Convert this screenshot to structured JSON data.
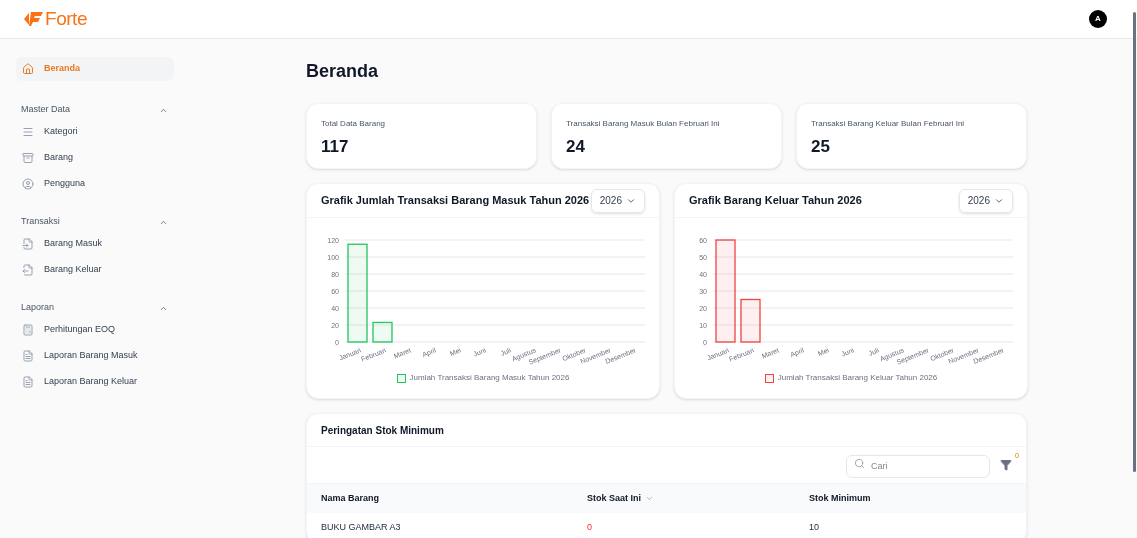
{
  "header": {
    "logo": "Forte",
    "avatar": "A"
  },
  "sidebar": {
    "home": {
      "label": "Beranda",
      "selected": true
    },
    "sections": [
      {
        "title": "Master Data",
        "expanded": true,
        "items": [
          {
            "label": "Kategori",
            "selected": false
          },
          {
            "label": "Barang",
            "selected": false
          },
          {
            "label": "Pengguna",
            "selected": false
          }
        ]
      },
      {
        "title": "Transaksi",
        "expanded": true,
        "items": [
          {
            "label": "Barang Masuk",
            "selected": false
          },
          {
            "label": "Barang Keluar",
            "selected": false
          }
        ]
      },
      {
        "title": "Laporan",
        "expanded": true,
        "items": [
          {
            "label": "Perhitungan EOQ",
            "selected": false
          },
          {
            "label": "Laporan Barang Masuk",
            "selected": false
          },
          {
            "label": "Laporan Barang Keluar",
            "selected": false
          }
        ]
      }
    ]
  },
  "page_title": "Beranda",
  "stats": [
    {
      "label": "Total Data Barang",
      "value": "117"
    },
    {
      "label": "Transaksi Barang Masuk Bulan Februari Ini",
      "value": "24"
    },
    {
      "label": "Transaksi Barang Keluar Bulan Februari Ini",
      "value": "25"
    }
  ],
  "charts": [
    {
      "title": "Grafik Jumlah Transaksi Barang Masuk Tahun 2026",
      "year_select": "2026",
      "chart_data": {
        "type": "bar",
        "categories": [
          "Januari",
          "Februari",
          "Maret",
          "April",
          "Mei",
          "Juni",
          "Juli",
          "Agustus",
          "September",
          "Oktober",
          "November",
          "Desember"
        ],
        "series": [
          {
            "name": "Jumlah Transaksi Barang Masuk Tahun 2026",
            "color": "#22c55e",
            "values": [
              115,
              23,
              0,
              0,
              0,
              0,
              0,
              0,
              0,
              0,
              0,
              0
            ]
          }
        ],
        "ylim": [
          0,
          120
        ],
        "grid": true,
        "yticks": [
          0,
          20,
          40,
          60,
          80,
          100,
          120
        ]
      }
    },
    {
      "title": "Grafik Barang Keluar Tahun 2026",
      "year_select": "2026",
      "chart_data": {
        "type": "bar",
        "categories": [
          "Januari",
          "Februari",
          "Maret",
          "April",
          "Mei",
          "Juni",
          "Juli",
          "Agustus",
          "September",
          "Oktober",
          "November",
          "Desember"
        ],
        "series": [
          {
            "name": "Jumlah Transaksi Barang Keluar Tahun 2026",
            "color": "#ef4444",
            "values": [
              60,
              25,
              0,
              0,
              0,
              0,
              0,
              0,
              0,
              0,
              0,
              0
            ]
          }
        ],
        "ylim": [
          0,
          60
        ],
        "grid": true,
        "yticks": [
          0,
          10,
          20,
          30,
          40,
          50,
          60
        ]
      }
    }
  ],
  "stock_table": {
    "title": "Peringatan Stok Minimum",
    "search": {
      "placeholder": "Cari"
    },
    "filter_count": "0",
    "columns": [
      {
        "label": "Nama Barang",
        "sortable": false
      },
      {
        "label": "Stok Saat Ini",
        "sortable": true
      },
      {
        "label": "Stok Minimum",
        "sortable": false
      }
    ],
    "rows": [
      {
        "cells": [
          {
            "text": "BUKU GAMBAR A3",
            "warning": false
          },
          {
            "text": "0",
            "warning": true
          },
          {
            "text": "10",
            "warning": false
          }
        ]
      }
    ]
  }
}
